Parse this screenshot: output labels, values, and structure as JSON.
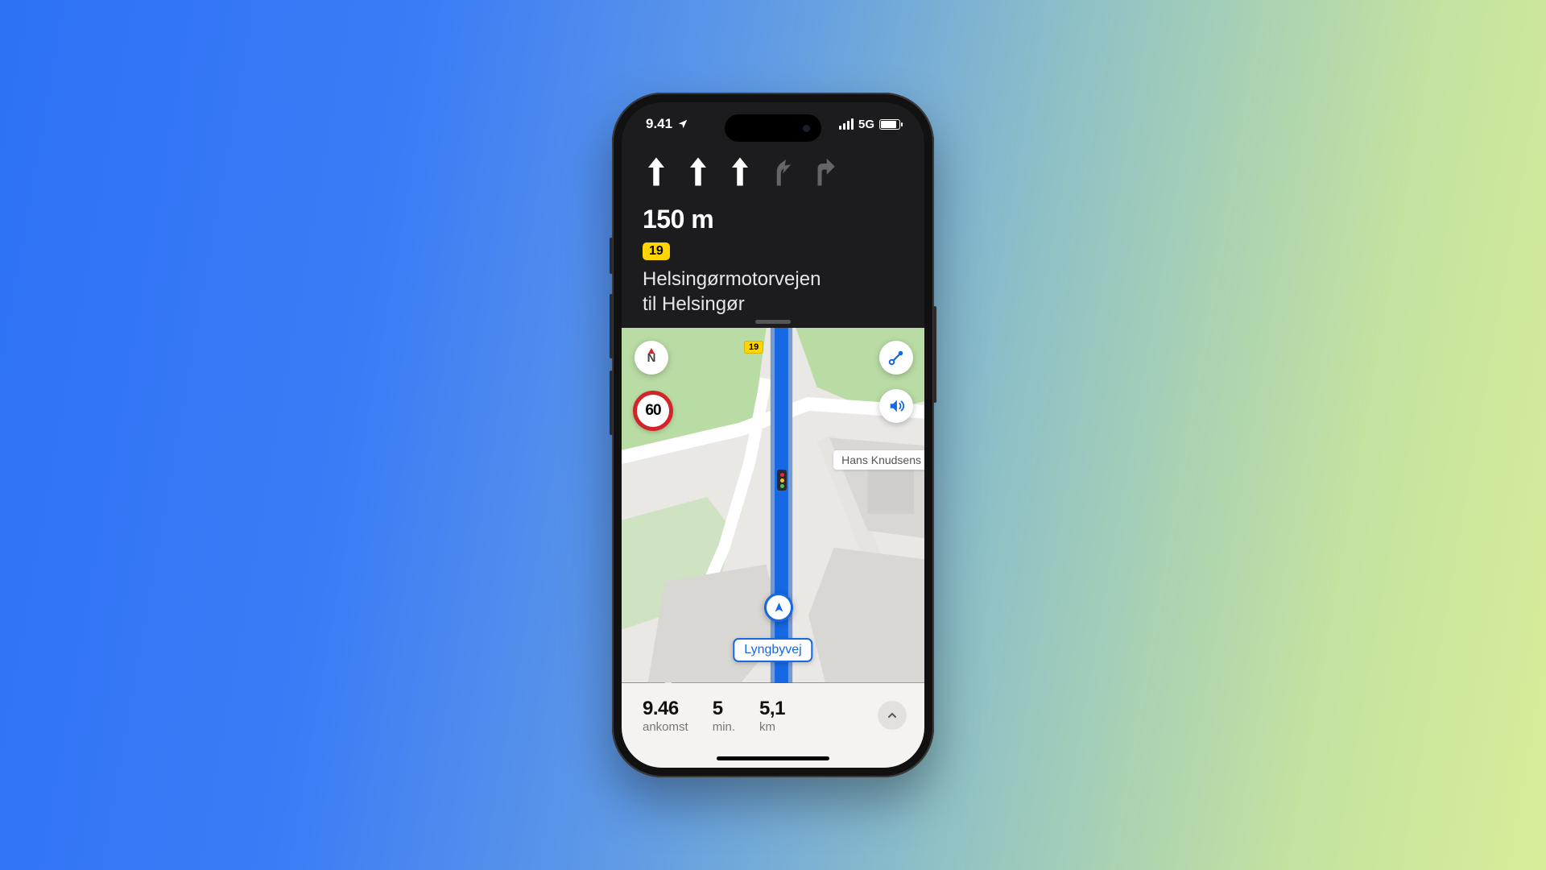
{
  "statusbar": {
    "time": "9.41",
    "network": "5G"
  },
  "banner": {
    "distance": "150 m",
    "shield": "19",
    "road_line1": "Helsingørmotorvejen",
    "road_line2": "til Helsingør"
  },
  "map": {
    "compass": "N",
    "speed_limit": "60",
    "mini_shield": "19",
    "poi": "Hans Knudsens",
    "street": "Lyngbyvej"
  },
  "bottom": {
    "arrival_value": "9.46",
    "arrival_label": "ankomst",
    "time_value": "5",
    "time_label": "min.",
    "dist_value": "5,1",
    "dist_label": "km"
  }
}
